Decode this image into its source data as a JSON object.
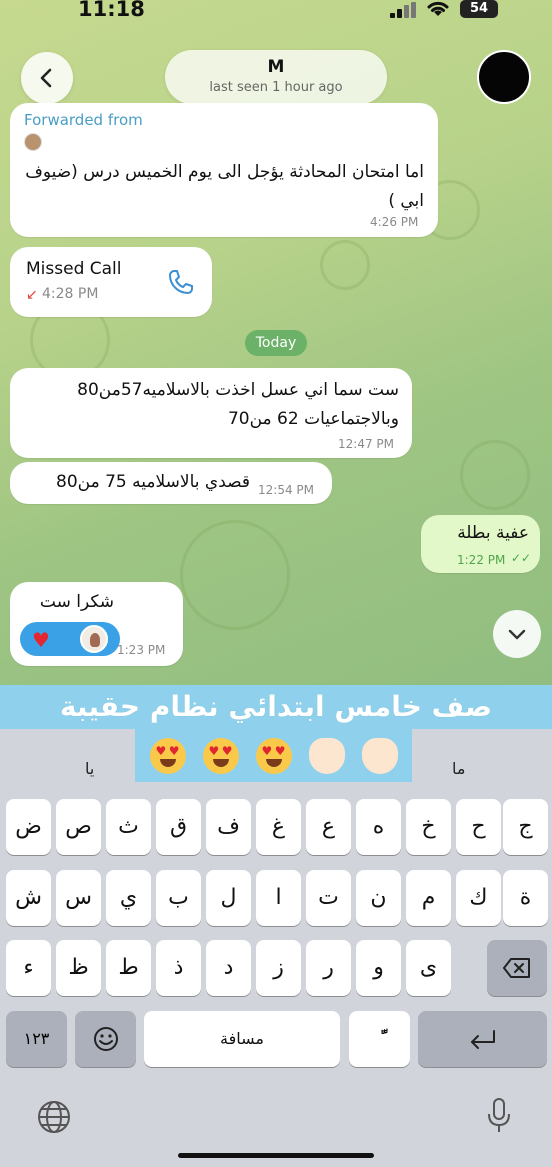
{
  "status_bar": {
    "time": "11:18",
    "battery": "54"
  },
  "header": {
    "name": "M",
    "status": "last seen 1 hour ago"
  },
  "messages": {
    "forwarded": {
      "label": "Forwarded from",
      "text": "اما امتحان المحادثة يؤجل الى يوم الخميس درس (ضيوف ابي )",
      "time": "4:26 PM"
    },
    "missed_call": {
      "title": "Missed Call",
      "time": "4:28 PM"
    },
    "date_chip": "Today",
    "msg1": {
      "text": "ست سما اني عسل اخذت بالاسلاميه57من80 وبالاجتماعيات 62 من70",
      "time": "12:47 PM"
    },
    "msg2": {
      "text": "قصدي بالاسلاميه 75 من80",
      "time": "12:54 PM"
    },
    "msg3": {
      "text": "عفية بطلة",
      "time": "1:22 PM"
    },
    "msg4": {
      "text": "شكرا ست",
      "time": "1:23 PM"
    }
  },
  "banner": {
    "text": "صف خامس ابتدائي نظام حقيبة"
  },
  "keyboard": {
    "suggest_left": "يا",
    "suggest_right": "ما",
    "row1": [
      "ض",
      "ص",
      "ث",
      "ق",
      "ف",
      "غ",
      "ع",
      "ه",
      "خ",
      "ح",
      "ج"
    ],
    "row2": [
      "ش",
      "س",
      "ي",
      "ب",
      "ل",
      "ا",
      "ت",
      "ن",
      "م",
      "ك",
      "ة"
    ],
    "row3": [
      "ء",
      "ظ",
      "ط",
      "ذ",
      "د",
      "ز",
      "ر",
      "و",
      "ى"
    ],
    "nums_label": "١٢٣",
    "space_label": "مسافة",
    "tanween_label": "ًّ"
  },
  "icons": {
    "back": "chevron-left-icon",
    "phone": "phone-icon",
    "heart": "heart-icon",
    "scroll_down": "chevron-down-icon",
    "globe": "globe-icon",
    "mic": "microphone-icon",
    "backspace": "backspace-icon",
    "return": "return-icon",
    "emoji": "smiley-icon"
  },
  "colors": {
    "accent": "#4a9dc4",
    "outgoing_bubble": "#e3f8c8",
    "date_chip": "#6bb268",
    "banner": "#8fd1ec",
    "missed_call_arrow": "#e0453a"
  }
}
